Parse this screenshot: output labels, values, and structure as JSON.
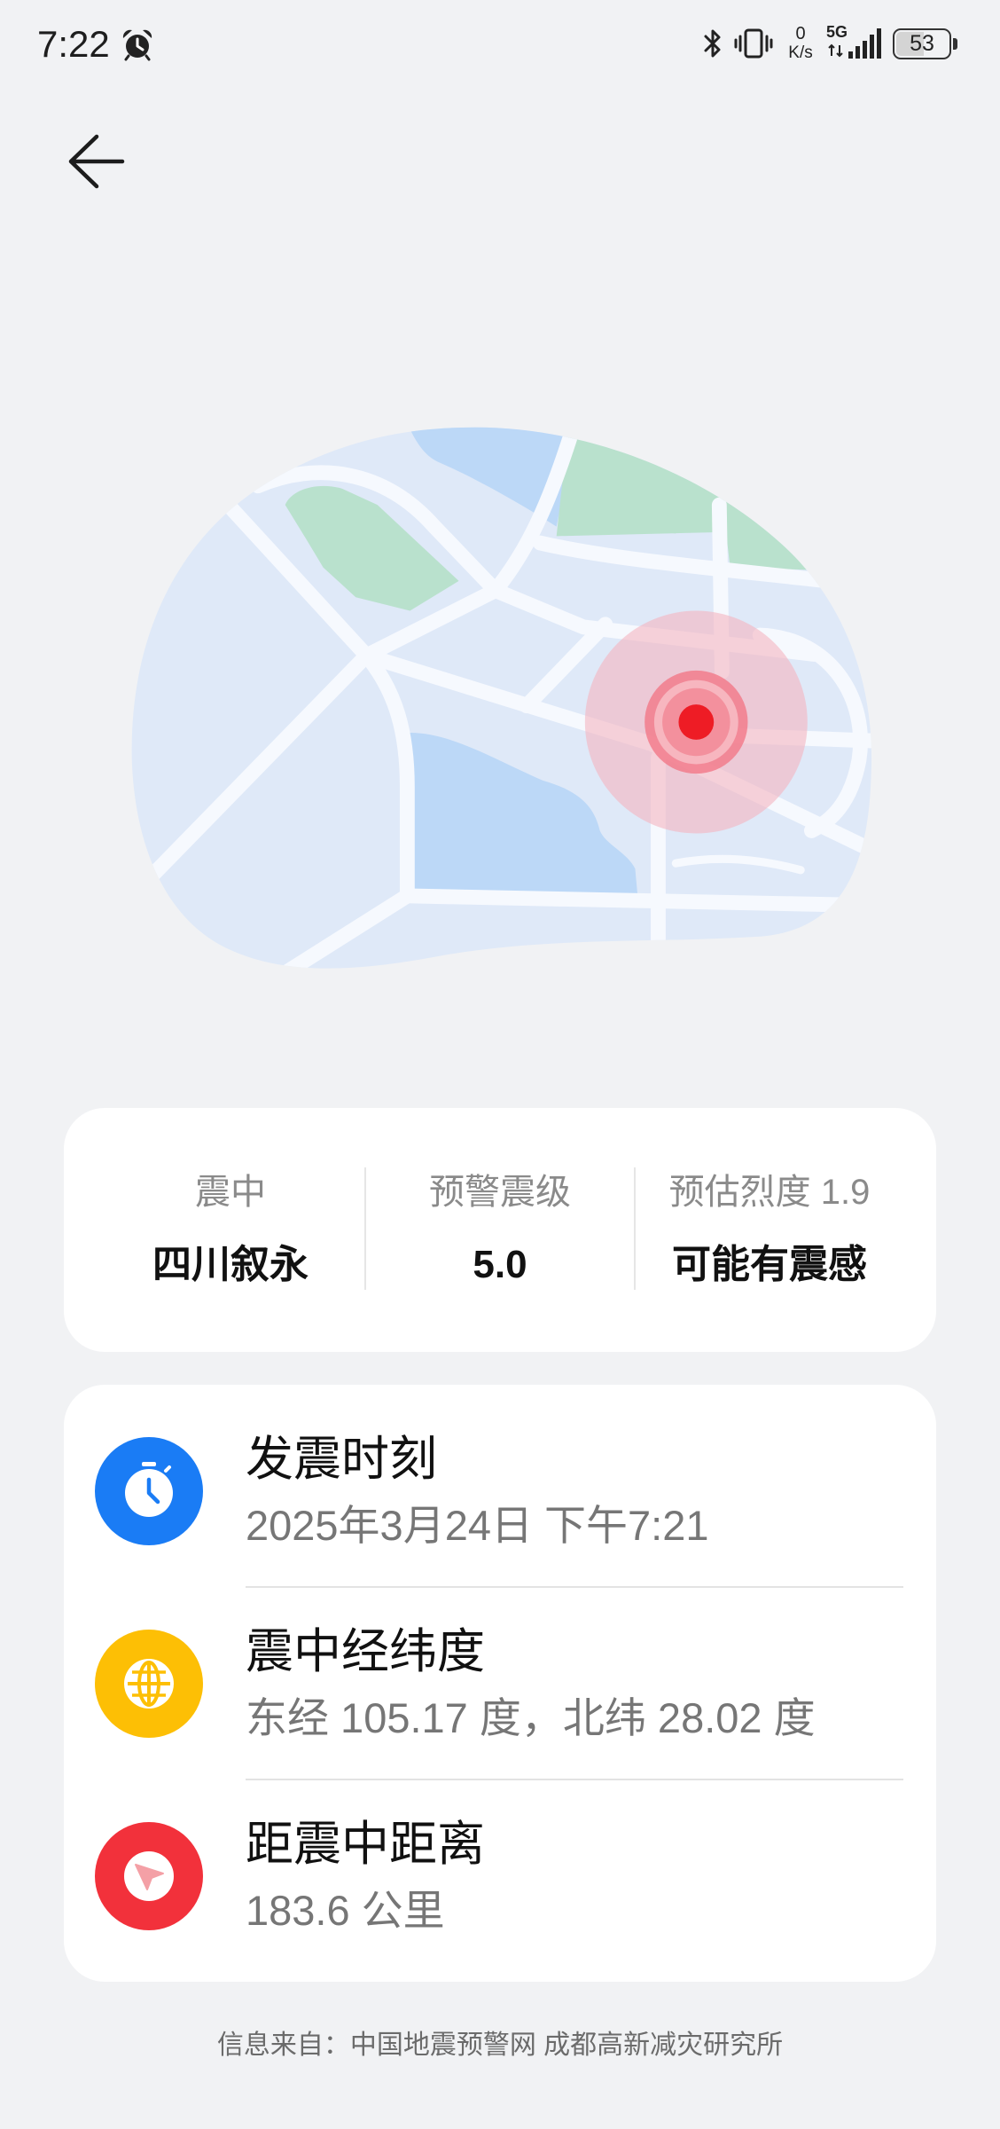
{
  "status_bar": {
    "time": "7:22",
    "alarm_icon": "alarm-clock-icon",
    "bluetooth_icon": "bluetooth-icon",
    "vibrate_icon": "vibrate-icon",
    "net_speed_value": "0",
    "net_speed_unit": "K/s",
    "network_type": "5G",
    "signal_icon": "signal-bars-icon",
    "battery_level": "53"
  },
  "header": {
    "back_icon": "arrow-left-icon"
  },
  "map": {
    "marker_icon": "epicenter-marker-icon",
    "marker_color": "#ee1c25"
  },
  "summary": [
    {
      "label": "震中",
      "value": "四川叙永"
    },
    {
      "label": "预警震级",
      "value": "5.0"
    },
    {
      "label": "预估烈度 1.9",
      "value": "可能有震感"
    }
  ],
  "details": [
    {
      "icon": "clock-icon",
      "icon_color": "#1a7cf5",
      "title": "发震时刻",
      "value": "2025年3月24日 下午7:21"
    },
    {
      "icon": "globe-icon",
      "icon_color": "#fdbf05",
      "title": "震中经纬度",
      "value": "东经 105.17 度，北纬 28.02 度"
    },
    {
      "icon": "location-arrow-icon",
      "icon_color": "#f2313b",
      "title": "距震中距离",
      "value": "183.6 公里"
    }
  ],
  "footer": {
    "source": "信息来自：中国地震预警网 成都高新减灾研究所"
  }
}
